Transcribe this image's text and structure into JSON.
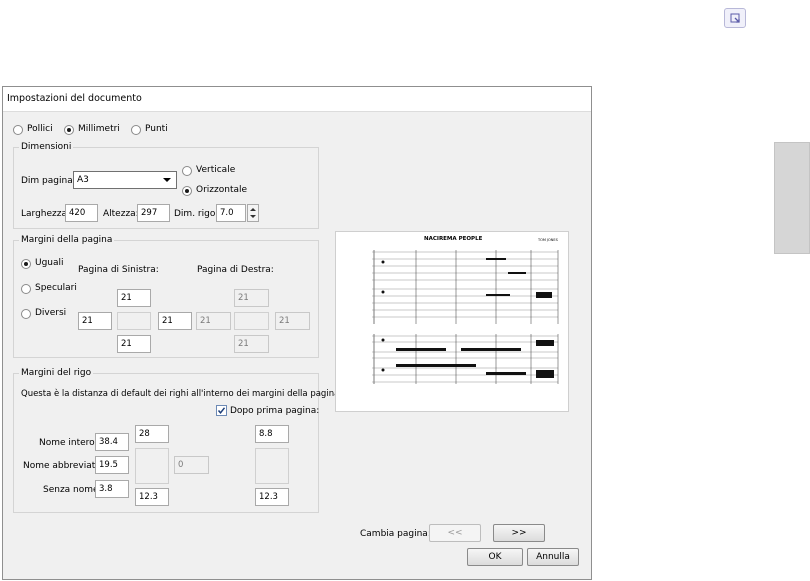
{
  "icons": {
    "corner": "resize-icon",
    "check": "check-icon",
    "spin_up": "arrow-up-icon",
    "spin_down": "arrow-down-icon",
    "dropdown": "chevron-down-icon"
  },
  "dialog": {
    "title": "Impostazioni del documento",
    "units": {
      "pollici": "Pollici",
      "millimetri": "Millimetri",
      "punti": "Punti"
    },
    "dimensioni": {
      "legend": "Dimensioni",
      "dim_pagina_label": "Dim pagina:",
      "dim_pagina_value": "A3",
      "verticale": "Verticale",
      "orizzontale": "Orizzontale",
      "larghezza_label": "Larghezza:",
      "larghezza": "420",
      "altezza_label": "Altezza:",
      "altezza": "297",
      "dim_rigo_label": "Dim. rigo:",
      "dim_rigo": "7.0"
    },
    "margini_pagina": {
      "legend": "Margini della pagina",
      "uguali": "Uguali",
      "speculari": "Speculari",
      "diversi": "Diversi",
      "sinistra_label": "Pagina di Sinistra:",
      "destra_label": "Pagina di Destra:",
      "sin": {
        "top": "21",
        "left": "21",
        "right": "21",
        "bottom": "21"
      },
      "des": {
        "top": "21",
        "left": "21",
        "right": "21",
        "bottom": "21"
      }
    },
    "margini_rigo": {
      "legend": "Margini del rigo",
      "description": "Questa è la distanza di default dei righi all'interno dei margini della pagina.",
      "dopo_prima_pagina": "Dopo prima pagina:",
      "nome_intero_label": "Nome intero:",
      "nome_intero": "38.4",
      "nome_abbreviato_label": "Nome abbreviato:",
      "nome_abbreviato": "19.5",
      "senza_nome_label": "Senza nome:",
      "senza_nome": "3.8",
      "top": "28",
      "bottom": "12.3",
      "right_disabled": "0",
      "dopo_top": "8.8",
      "dopo_bottom": "12.3"
    },
    "preview": {
      "title": "NACIREMA PEOPLE",
      "composer": "TOM JONES"
    },
    "cambia_pagina": "Cambia pagina:",
    "prev": "<<",
    "next": ">>",
    "ok": "OK",
    "annulla": "Annulla"
  }
}
